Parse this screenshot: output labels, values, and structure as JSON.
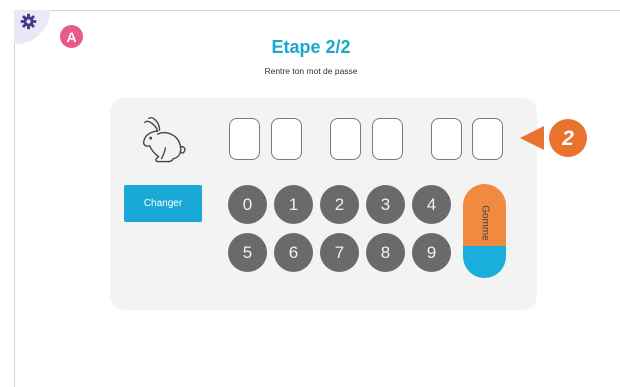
{
  "header": {
    "title": "Etape 2/2",
    "subtitle": "Rentre ton mot de passe",
    "avatar_letter": "A"
  },
  "icons": {
    "settings": "gear-icon",
    "animal": "rabbit-icon"
  },
  "password": {
    "slots": [
      "",
      "",
      "",
      "",
      "",
      ""
    ]
  },
  "buttons": {
    "change": "Changer",
    "erase": "Gomme"
  },
  "keypad": {
    "keys": [
      "0",
      "1",
      "2",
      "3",
      "4",
      "5",
      "6",
      "7",
      "8",
      "9"
    ]
  },
  "callout": {
    "number": "2"
  },
  "colors": {
    "accent": "#1aa9cc",
    "avatar": "#e65a8c",
    "key": "#6a6a6a",
    "erase_top": "#f08a3e",
    "erase_bottom": "#1aaedc",
    "callout": "#e8732f"
  }
}
